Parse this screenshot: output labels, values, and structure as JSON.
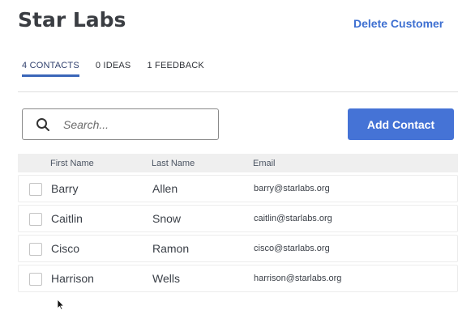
{
  "header": {
    "title": "Star Labs",
    "delete_label": "Delete Customer"
  },
  "tabs": [
    {
      "label": "4 CONTACTS",
      "active": true
    },
    {
      "label": "0 IDEAS",
      "active": false
    },
    {
      "label": "1 FEEDBACK",
      "active": false
    }
  ],
  "search": {
    "placeholder": "Search...",
    "icon": "search-icon"
  },
  "add_contact_label": "Add Contact",
  "table": {
    "columns": [
      "First Name",
      "Last Name",
      "Email"
    ],
    "rows": [
      {
        "first": "Barry",
        "last": "Allen",
        "email": "barry@starlabs.org"
      },
      {
        "first": "Caitlin",
        "last": "Snow",
        "email": "caitlin@starlabs.org"
      },
      {
        "first": "Cisco",
        "last": "Ramon",
        "email": "cisco@starlabs.org"
      },
      {
        "first": "Harrison",
        "last": "Wells",
        "email": "harrison@starlabs.org"
      }
    ]
  },
  "colors": {
    "accent": "#4573d6",
    "link": "#3d6fd1",
    "active_tab_underline": "#3a66b8"
  }
}
